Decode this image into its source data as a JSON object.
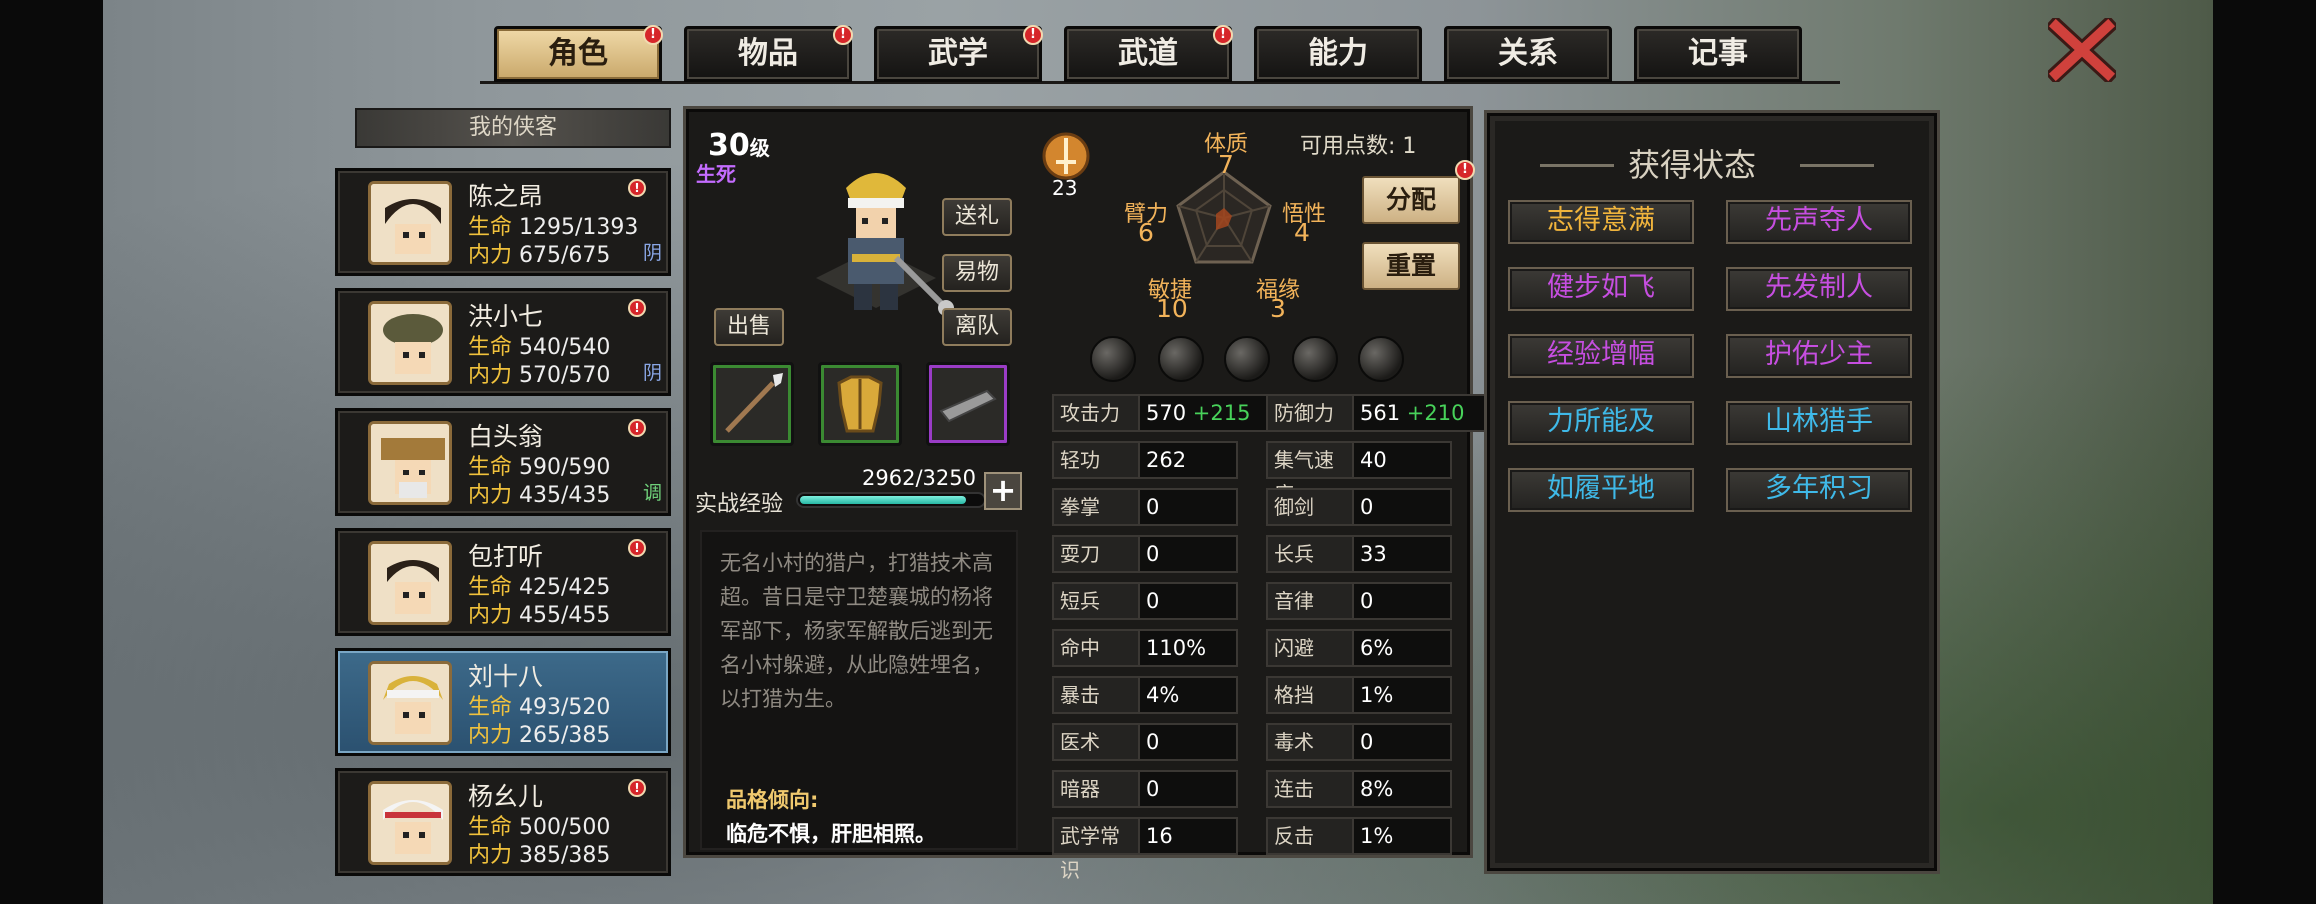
{
  "tabs": [
    {
      "label": "角色",
      "badge": "!",
      "active": true
    },
    {
      "label": "物品",
      "badge": "!"
    },
    {
      "label": "武学",
      "badge": "!"
    },
    {
      "label": "武道",
      "badge": "!"
    },
    {
      "label": "能力"
    },
    {
      "label": "关系"
    },
    {
      "label": "记事"
    }
  ],
  "roster": {
    "header": "我的侠客",
    "hp_label": "生命",
    "mp_label": "内力",
    "characters": [
      {
        "name": "陈之昂",
        "hp": "1295/1393",
        "mp": "675/675",
        "tag": "阴",
        "badge": "!"
      },
      {
        "name": "洪小七",
        "hp": "540/540",
        "mp": "570/570",
        "tag": "阴",
        "badge": "!"
      },
      {
        "name": "白头翁",
        "hp": "590/590",
        "mp": "435/435",
        "tag": "调",
        "badge": "!"
      },
      {
        "name": "包打听",
        "hp": "425/425",
        "mp": "455/455",
        "badge": "!"
      },
      {
        "name": "刘十八",
        "hp": "493/520",
        "mp": "265/385",
        "selected": true
      },
      {
        "name": "杨幺儿",
        "hp": "500/500",
        "mp": "385/385",
        "badge": "!"
      }
    ]
  },
  "hero": {
    "level": "30",
    "level_unit": "级",
    "rank": "生死",
    "buttons": {
      "gift": "送礼",
      "trade": "易物",
      "leave": "离队",
      "sell": "出售"
    },
    "xp_label": "实战经验",
    "xp_value": "2962/3250",
    "xp_fraction": 0.911,
    "bio": "无名小村的猎户，打猎技术高超。昔日是守卫楚襄城的杨将军部下，杨家军解散后逃到无名小村躲避，从此隐姓埋名，以打猎为生。",
    "trait_title": "品格倾向:",
    "trait_text": "临危不惧，肝胆相照。"
  },
  "attributes": {
    "icon_value": "23",
    "points_label": "可用点数:",
    "points_value": "1",
    "allocate_label": "分配",
    "reset_label": "重置",
    "badge": "!",
    "tizhi": {
      "label": "体质",
      "value": "7"
    },
    "wuxing": {
      "label": "悟性",
      "value": "4"
    },
    "fuyuan": {
      "label": "福缘",
      "value": "3"
    },
    "minjie": {
      "label": "敏捷",
      "value": "10"
    },
    "bili": {
      "label": "臂力",
      "value": "6"
    }
  },
  "stats_left": [
    {
      "label": "攻击力",
      "value": "570",
      "bonus": "+215"
    },
    {
      "label": "轻功",
      "value": "262"
    },
    {
      "label": "拳掌",
      "value": "0"
    },
    {
      "label": "耍刀",
      "value": "0"
    },
    {
      "label": "短兵",
      "value": "0"
    },
    {
      "label": "命中",
      "value": "110%"
    },
    {
      "label": "暴击",
      "value": "4%"
    },
    {
      "label": "医术",
      "value": "0"
    },
    {
      "label": "暗器",
      "value": "0"
    },
    {
      "label": "武学常识",
      "value": "16"
    }
  ],
  "stats_right": [
    {
      "label": "防御力",
      "value": "561",
      "bonus": "+210"
    },
    {
      "label": "集气速度",
      "value": "40"
    },
    {
      "label": "御剑",
      "value": "0"
    },
    {
      "label": "长兵",
      "value": "33"
    },
    {
      "label": "音律",
      "value": "0"
    },
    {
      "label": "闪避",
      "value": "6%"
    },
    {
      "label": "格挡",
      "value": "1%"
    },
    {
      "label": "毒术",
      "value": "0"
    },
    {
      "label": "连击",
      "value": "8%"
    },
    {
      "label": "反击",
      "value": "1%"
    }
  ],
  "status": {
    "title": "获得状态",
    "items": [
      {
        "label": "志得意满",
        "color": "#f0b43c"
      },
      {
        "label": "先声夺人",
        "color": "#c64ee0"
      },
      {
        "label": "健步如飞",
        "color": "#c64ee0"
      },
      {
        "label": "先发制人",
        "color": "#c64ee0"
      },
      {
        "label": "经验增幅",
        "color": "#c64ee0"
      },
      {
        "label": "护佑少主",
        "color": "#c64ee0"
      },
      {
        "label": "力所能及",
        "color": "#3fb9e8"
      },
      {
        "label": "山林猎手",
        "color": "#3fb9e8"
      },
      {
        "label": "如履平地",
        "color": "#3fb9e8"
      },
      {
        "label": "多年积习",
        "color": "#3fb9e8"
      }
    ]
  },
  "colors": {
    "tag_yin": "#8aa7e6",
    "tag_tiao": "#6fd07a",
    "accent": "#f2b35a"
  }
}
